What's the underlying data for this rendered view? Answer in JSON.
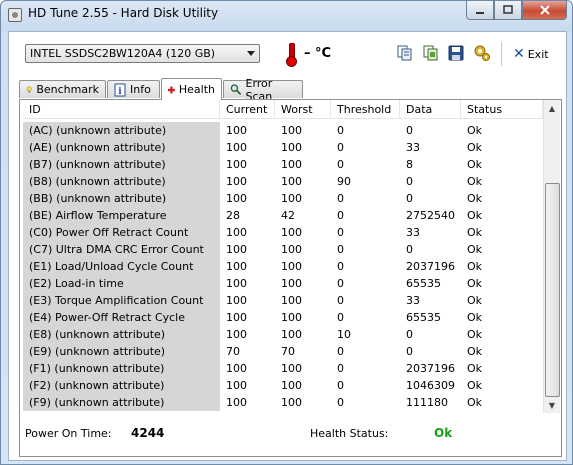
{
  "window": {
    "title": "HD Tune 2.55 - Hard Disk Utility"
  },
  "toolbar": {
    "drive": "INTEL SSDSC2BW120A4 (120 GB)",
    "temperature": "– °C",
    "exit_label": "Exit"
  },
  "tabs": [
    {
      "label": "Benchmark",
      "icon": "lightbulb-icon"
    },
    {
      "label": "Info",
      "icon": "info-icon"
    },
    {
      "label": "Health",
      "icon": "red-cross-icon",
      "active": true
    },
    {
      "label": "Error Scan",
      "icon": "magnifier-icon"
    }
  ],
  "table": {
    "headers": [
      "ID",
      "Current",
      "Worst",
      "Threshold",
      "Data",
      "Status"
    ],
    "rows": [
      [
        "(AC) (unknown attribute)",
        "100",
        "100",
        "0",
        "0",
        "Ok"
      ],
      [
        "(AE) (unknown attribute)",
        "100",
        "100",
        "0",
        "33",
        "Ok"
      ],
      [
        "(B7) (unknown attribute)",
        "100",
        "100",
        "0",
        "8",
        "Ok"
      ],
      [
        "(B8) (unknown attribute)",
        "100",
        "100",
        "90",
        "0",
        "Ok"
      ],
      [
        "(BB) (unknown attribute)",
        "100",
        "100",
        "0",
        "0",
        "Ok"
      ],
      [
        "(BE) Airflow Temperature",
        "28",
        "42",
        "0",
        "2752540",
        "Ok"
      ],
      [
        "(C0) Power Off Retract Count",
        "100",
        "100",
        "0",
        "33",
        "Ok"
      ],
      [
        "(C7) Ultra DMA CRC Error Count",
        "100",
        "100",
        "0",
        "0",
        "Ok"
      ],
      [
        "(E1) Load/Unload Cycle Count",
        "100",
        "100",
        "0",
        "2037196",
        "Ok"
      ],
      [
        "(E2) Load-in time",
        "100",
        "100",
        "0",
        "65535",
        "Ok"
      ],
      [
        "(E3) Torque Amplification Count",
        "100",
        "100",
        "0",
        "33",
        "Ok"
      ],
      [
        "(E4) Power-Off Retract Cycle",
        "100",
        "100",
        "0",
        "65535",
        "Ok"
      ],
      [
        "(E8) (unknown attribute)",
        "100",
        "100",
        "10",
        "0",
        "Ok"
      ],
      [
        "(E9) (unknown attribute)",
        "70",
        "70",
        "0",
        "0",
        "Ok"
      ],
      [
        "(F1) (unknown attribute)",
        "100",
        "100",
        "0",
        "2037196",
        "Ok"
      ],
      [
        "(F2) (unknown attribute)",
        "100",
        "100",
        "0",
        "1046309",
        "Ok"
      ],
      [
        "(F9) (unknown attribute)",
        "100",
        "100",
        "0",
        "111180",
        "Ok"
      ]
    ]
  },
  "footer": {
    "power_on_label": "Power On Time:",
    "power_on_value": "4244",
    "health_label": "Health Status:",
    "health_value": "Ok",
    "health_color": "#13a013"
  }
}
